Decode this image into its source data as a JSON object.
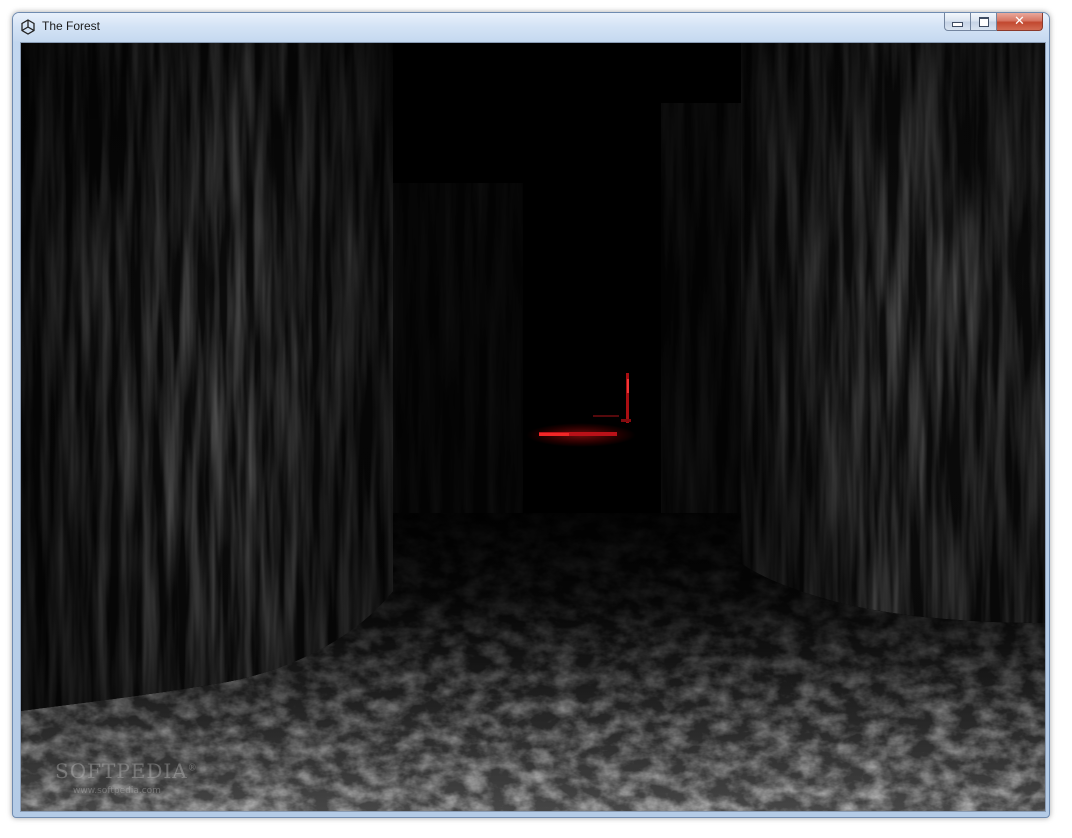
{
  "window": {
    "title": "The Forest",
    "app_icon": "unity-icon",
    "controls": {
      "minimize_icon": "minimize-icon",
      "maximize_icon": "maximize-icon",
      "close_icon": "close-icon",
      "close_glyph": "✕"
    }
  },
  "watermark": {
    "brand": "SOFTPEDIA",
    "trademark": "®",
    "url": "www.softpedia.com"
  },
  "colors": {
    "sky": "#000000",
    "accent_light": "#d1141a"
  }
}
